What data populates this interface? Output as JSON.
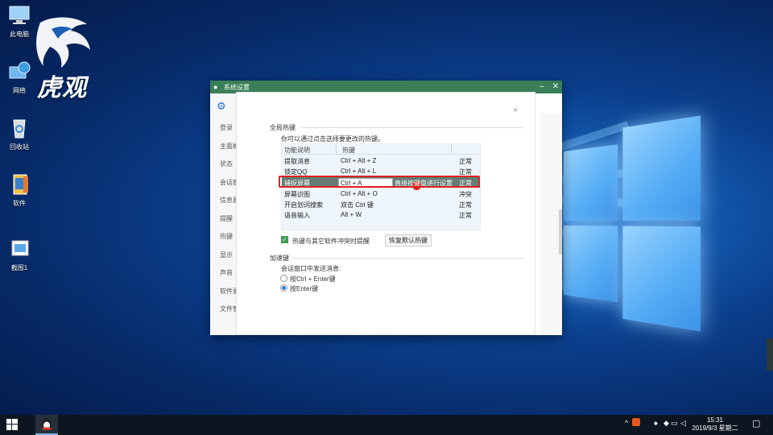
{
  "desktop": {
    "brand_text": "虎观",
    "icons": [
      {
        "label": "此电脑",
        "icon": "computer-icon"
      },
      {
        "label": "网络",
        "icon": "network-icon"
      },
      {
        "label": "回收站",
        "icon": "recycle-bin-icon"
      },
      {
        "label": "软件",
        "icon": "folder-icon"
      },
      {
        "label": "截图1",
        "icon": "image-file-icon"
      }
    ]
  },
  "window": {
    "title": "系统设置",
    "buttons": {
      "minimize": "–",
      "close": "✕"
    },
    "nav_items": [
      "登录",
      "主面板",
      "状态",
      "会话窗口",
      "信息展示",
      "提醒",
      "热键",
      "显示",
      "声音",
      "软件更新",
      "文件管理"
    ]
  },
  "hotkeys": {
    "section_title": "全局热键",
    "description": "你可以通过点击选择要更改的热键。",
    "columns": [
      "功能说明",
      "热键",
      ""
    ],
    "rows": [
      {
        "name": "提取消息",
        "key": "Ctrl + Alt + Z",
        "status": "正常"
      },
      {
        "name": "锁定QQ",
        "key": "Ctrl + Alt + L",
        "status": "正常"
      },
      {
        "name": "捕捉屏幕",
        "key": "Ctrl + A",
        "hint": "直接按键盘进行设置",
        "status": "正常",
        "selected": true
      },
      {
        "name": "屏幕识图",
        "key": "Ctrl + Alt + O",
        "status": "冲突"
      },
      {
        "name": "开启划词搜索",
        "key": "双击 Ctrl 键",
        "status": "正常"
      },
      {
        "name": "语音输入",
        "key": "Alt + W",
        "status": "正常"
      }
    ],
    "conflict_checkbox": {
      "label": "热键与其它软件冲突时提醒",
      "checked": true
    },
    "restore_button": "恢复默认热键"
  },
  "accelerator": {
    "section_title": "加速键",
    "prompt": "会话窗口中发送消息:",
    "options": [
      {
        "label": "按Ctrl + Enter键",
        "selected": false
      },
      {
        "label": "按Enter键",
        "selected": true
      }
    ]
  },
  "taskbar": {
    "time": "15:31",
    "date": "2019/9/3 星期二"
  },
  "colors": {
    "titlebar": "#3a7e57",
    "selected_row": "#657d74",
    "highlight_box": "#e02020",
    "taskbar": "#0d1620"
  }
}
